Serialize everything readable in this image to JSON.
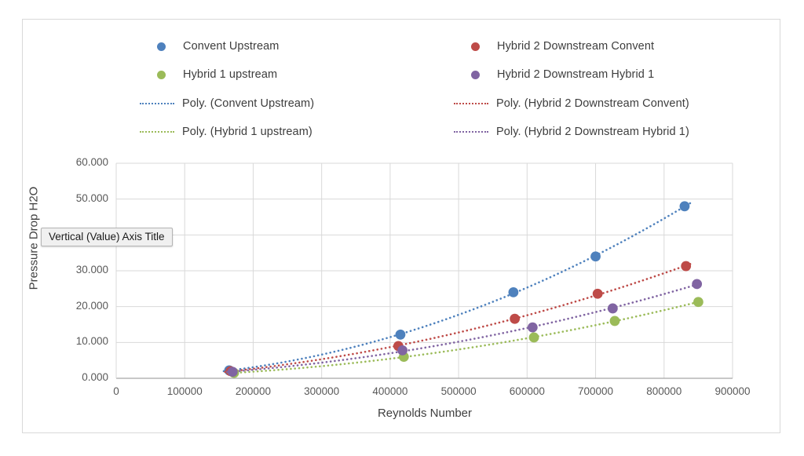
{
  "chart_data": {
    "type": "scatter",
    "title": "",
    "xlabel": "Reynolds Number",
    "ylabel": "Pressure Drop  H2O",
    "xlim": [
      0,
      900000
    ],
    "ylim": [
      0,
      60
    ],
    "xticks": [
      "0",
      "100000",
      "200000",
      "300000",
      "400000",
      "500000",
      "600000",
      "700000",
      "800000",
      "900000"
    ],
    "yticks": [
      "0.000",
      "10.000",
      "20.000",
      "30.000",
      "40.000",
      "50.000",
      "60.000"
    ],
    "grid": true,
    "legend_position": "top",
    "series": [
      {
        "name": "Convent Upstream",
        "color": "#4E81BD",
        "trend_label": "Poly.  (Convent Upstream)",
        "x": [
          165000,
          415000,
          580000,
          700000,
          830000
        ],
        "y": [
          2.2,
          12.2,
          24.0,
          34.0,
          48.0
        ]
      },
      {
        "name": "Hybrid 2 Downstream Convent",
        "color": "#BE4B48",
        "trend_label": "Poly.  (Hybrid 2 Downstream Convent)",
        "x": [
          167000,
          412000,
          582000,
          703000,
          832000
        ],
        "y": [
          2.0,
          9.0,
          16.6,
          23.6,
          31.3
        ]
      },
      {
        "name": "Hybrid 1 upstream",
        "color": "#9BBB59",
        "trend_label": "Poly.  (Hybrid 1 upstream)",
        "x": [
          172000,
          420000,
          610000,
          728000,
          850000
        ],
        "y": [
          1.5,
          6.0,
          11.4,
          16.0,
          21.3
        ]
      },
      {
        "name": "Hybrid 2 Downstream Hybrid 1",
        "color": "#8064A2",
        "trend_label": "Poly.  (Hybrid 2 Downstream Hybrid 1)",
        "x": [
          170000,
          418000,
          608000,
          725000,
          848000
        ],
        "y": [
          1.8,
          7.8,
          14.2,
          19.5,
          26.3
        ]
      }
    ]
  },
  "legend": {
    "markers": [
      {
        "label": "Convent Upstream",
        "color": "#4E81BD"
      },
      {
        "label": "Hybrid 2 Downstream Convent",
        "color": "#BE4B48"
      },
      {
        "label": "Hybrid 1 upstream",
        "color": "#9BBB59"
      },
      {
        "label": "Hybrid 2 Downstream Hybrid 1",
        "color": "#8064A2"
      }
    ],
    "trends": [
      {
        "label": "Poly.  (Convent Upstream)",
        "color": "#4E81BD"
      },
      {
        "label": "Poly.  (Hybrid 2 Downstream Convent)",
        "color": "#BE4B48"
      },
      {
        "label": "Poly.  (Hybrid 1 upstream)",
        "color": "#9BBB59"
      },
      {
        "label": "Poly.  (Hybrid 2 Downstream Hybrid 1)",
        "color": "#8064A2"
      }
    ]
  },
  "axis_titles": {
    "vertical": "Pressure Drop  H2O",
    "horizontal": "Reynolds Number"
  },
  "tooltip": {
    "text": "Vertical (Value) Axis Title"
  }
}
